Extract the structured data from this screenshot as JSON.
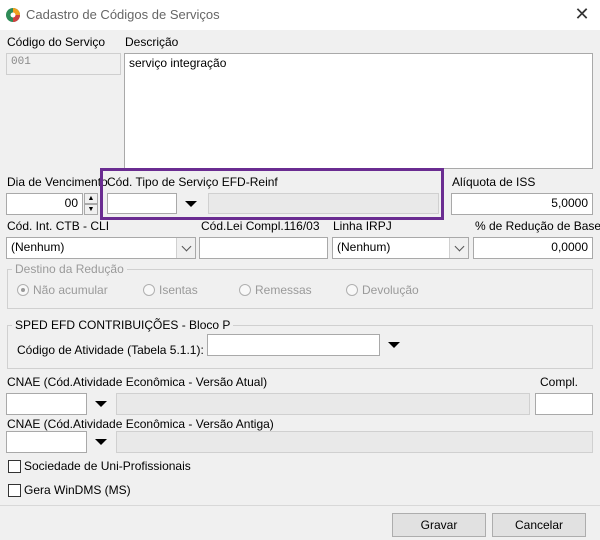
{
  "window": {
    "title": "Cadastro de Códigos de Serviços",
    "close": "✕"
  },
  "codigo": {
    "label": "Código do Serviço",
    "value": "001"
  },
  "descricao": {
    "label": "Descrição",
    "value": "serviço integração"
  },
  "vencimento": {
    "label": "Dia de Vencimento",
    "value": "00"
  },
  "efd_reinf": {
    "label": "Cód. Tipo de Serviço EFD-Reinf",
    "value": "",
    "description": ""
  },
  "iss": {
    "label": "Alíquota de ISS",
    "value": "5,0000"
  },
  "ctb": {
    "label": "Cód. Int. CTB - CLI",
    "value": "(Nenhum)"
  },
  "lei": {
    "label": "Cód.Lei Compl.116/03",
    "value": ""
  },
  "irpj": {
    "label": "Linha IRPJ",
    "value": "(Nenhum)"
  },
  "reducao": {
    "label": "% de Redução de Base",
    "value": "0,0000"
  },
  "destino": {
    "legend": "Destino da Redução",
    "options": [
      "Não acumular",
      "Isentas",
      "Remessas",
      "Devolução"
    ],
    "selected": "Não acumular"
  },
  "sped": {
    "legend": "SPED EFD CONTRIBUIÇÕES - Bloco P",
    "atividade_label": "Código de Atividade (Tabela 5.1.1):",
    "atividade_value": ""
  },
  "cnae_atual": {
    "label": "CNAE (Cód.Atividade Econômica - Versão Atual)",
    "value": "",
    "description": ""
  },
  "compl": {
    "label": "Compl.",
    "value": ""
  },
  "cnae_antiga": {
    "label": "CNAE (Cód.Atividade Econômica - Versão Antiga)",
    "value": "",
    "description": ""
  },
  "checks": {
    "uni_prof": "Sociedade de Uni-Profissionais",
    "windms": "Gera WinDMS (MS)"
  },
  "buttons": {
    "gravar": "Gravar",
    "cancelar": "Cancelar"
  },
  "colors": {
    "highlight": "#6a2c91",
    "window_bg": "#f0f0f0"
  }
}
